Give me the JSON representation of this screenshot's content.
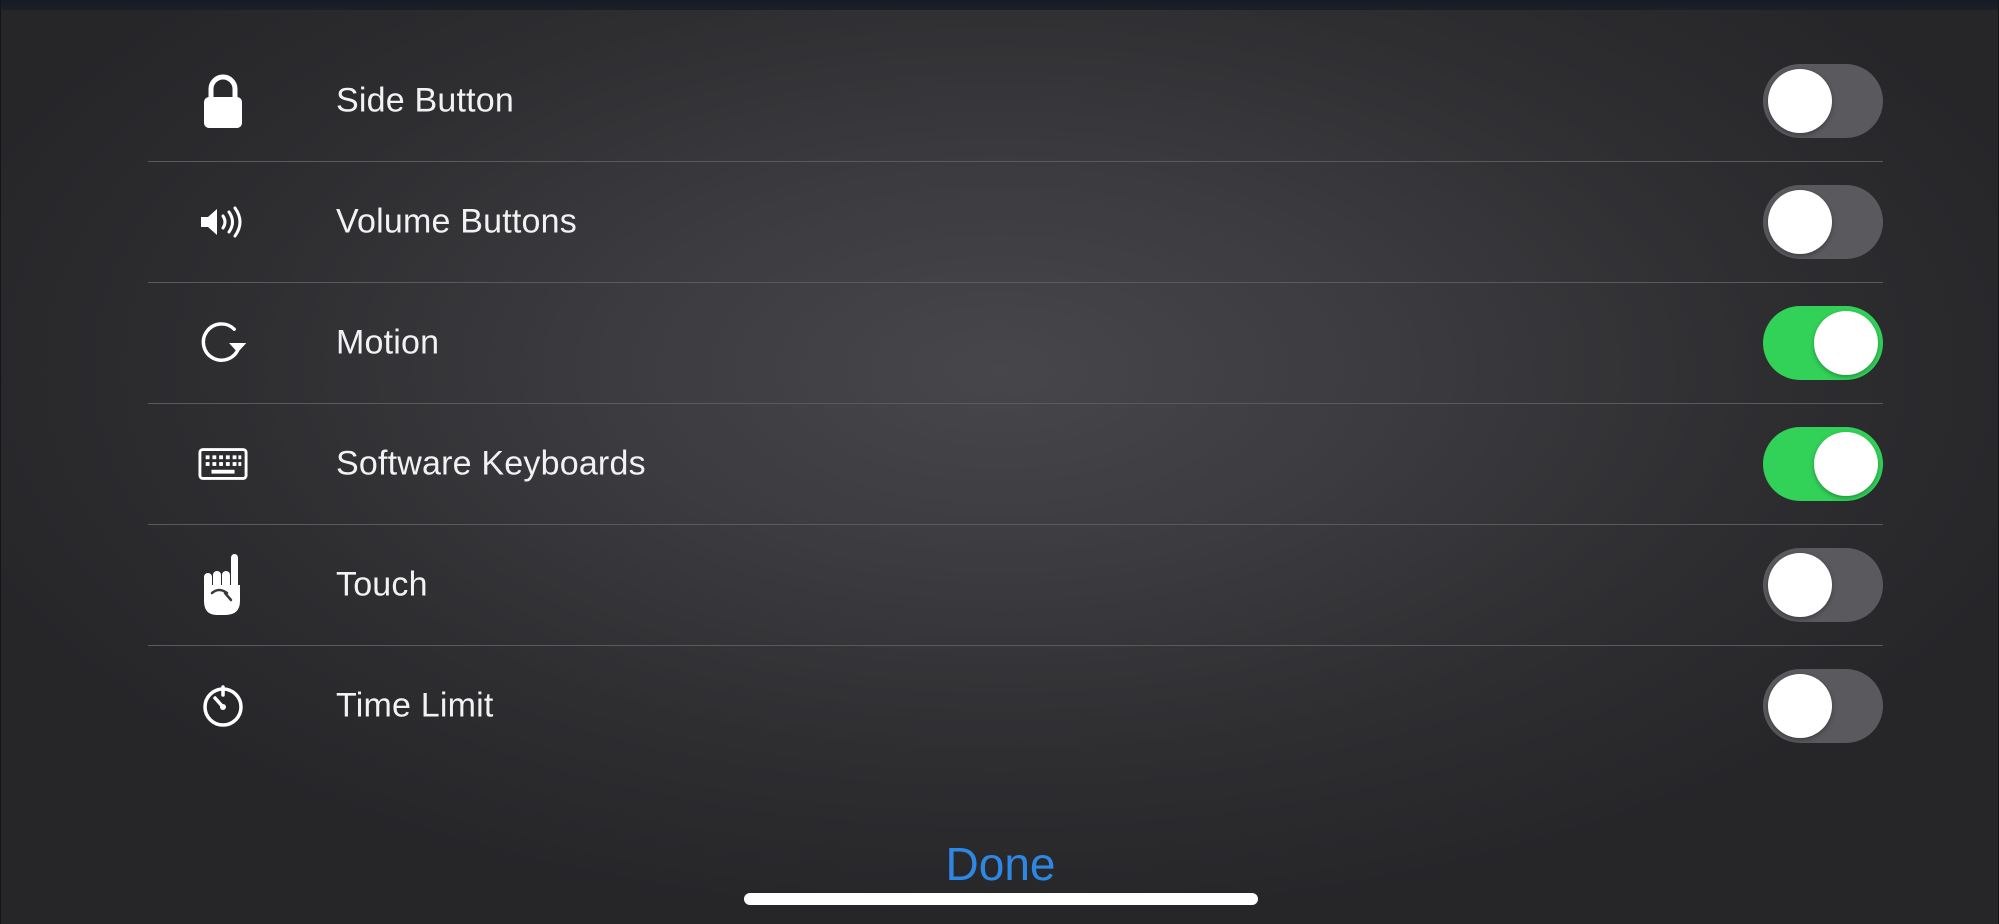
{
  "options": [
    {
      "label": "Side Button",
      "icon": "lock-icon",
      "enabled": false
    },
    {
      "label": "Volume Buttons",
      "icon": "speaker-icon",
      "enabled": false
    },
    {
      "label": "Motion",
      "icon": "rotate-icon",
      "enabled": true
    },
    {
      "label": "Software Keyboards",
      "icon": "keyboard-icon",
      "enabled": true
    },
    {
      "label": "Touch",
      "icon": "hand-pointer-icon",
      "enabled": false
    },
    {
      "label": "Time Limit",
      "icon": "timer-icon",
      "enabled": false
    }
  ],
  "done_label": "Done",
  "colors": {
    "toggle_on": "#32d158",
    "toggle_off": "#59595e",
    "accent": "#2f87e4"
  }
}
